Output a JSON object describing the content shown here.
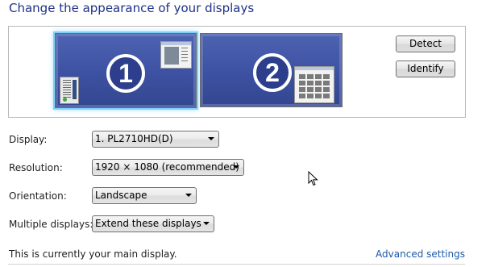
{
  "title": "Change the appearance of your displays",
  "monitors": [
    {
      "number": "1",
      "selected": true
    },
    {
      "number": "2",
      "selected": false
    }
  ],
  "buttons": {
    "detect": "Detect",
    "identify": "Identify"
  },
  "settings": {
    "display": {
      "label": "Display:",
      "value": "1. PL2710HD(D)"
    },
    "resolution": {
      "label": "Resolution:",
      "value": "1920 × 1080 (recommended)"
    },
    "orientation": {
      "label": "Orientation:",
      "value": "Landscape"
    },
    "multiple_displays": {
      "label": "Multiple displays:",
      "value": "Extend these displays"
    }
  },
  "status_text": "This is currently your main display.",
  "advanced_link": "Advanced settings",
  "colors": {
    "title": "#1e3287",
    "link": "#1c5aa6",
    "monitor_fill": "#3d51a2",
    "selection_glow": "#7fd0f8"
  }
}
